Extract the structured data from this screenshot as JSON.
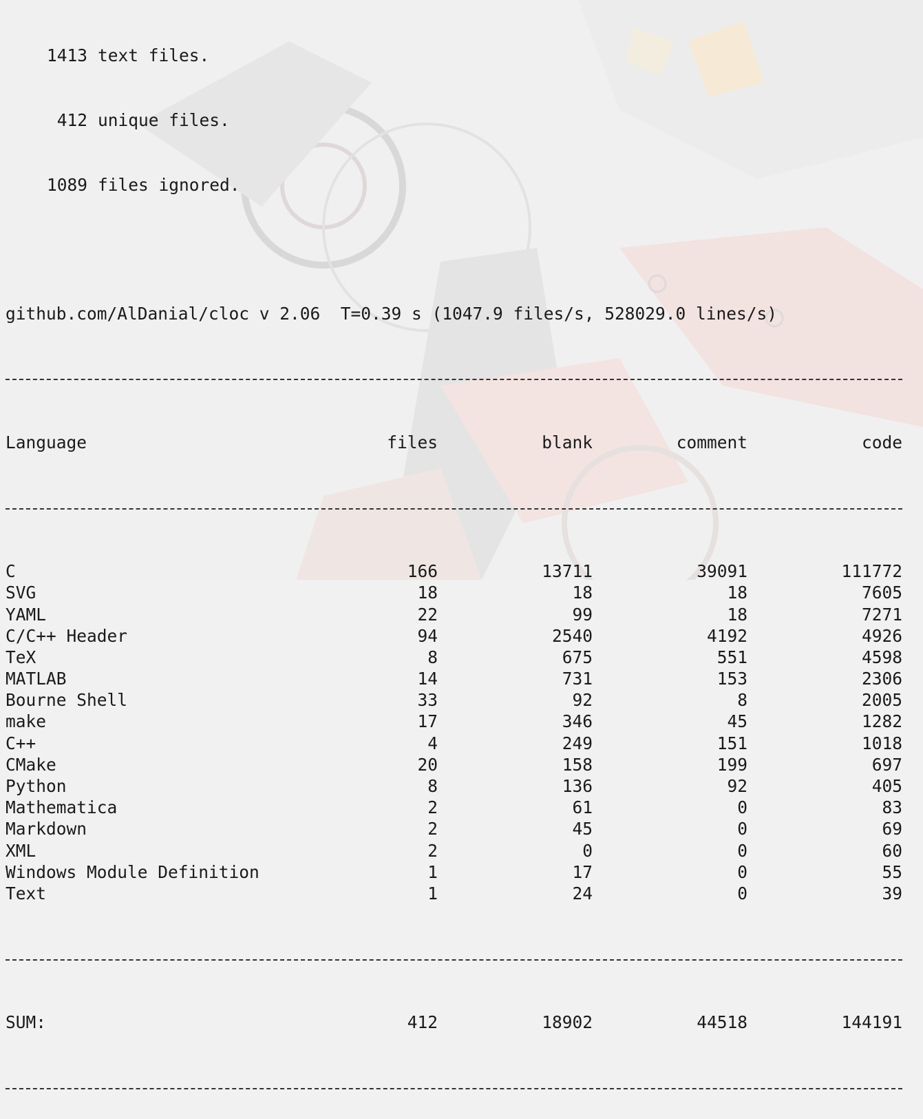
{
  "summary": [
    {
      "count": "1413",
      "text": "text files."
    },
    {
      "count": "412",
      "text": "unique files."
    },
    {
      "count": "1089",
      "text": "files ignored."
    }
  ],
  "header_line": "github.com/AlDanial/cloc v 2.06  T=0.39 s (1047.9 files/s, 528029.0 lines/s)",
  "columns": {
    "language": "Language",
    "files": "files",
    "blank": "blank",
    "comment": "comment",
    "code": "code"
  },
  "rows": [
    {
      "language": "C",
      "files": "166",
      "blank": "13711",
      "comment": "39091",
      "code": "111772"
    },
    {
      "language": "SVG",
      "files": "18",
      "blank": "18",
      "comment": "18",
      "code": "7605"
    },
    {
      "language": "YAML",
      "files": "22",
      "blank": "99",
      "comment": "18",
      "code": "7271"
    },
    {
      "language": "C/C++ Header",
      "files": "94",
      "blank": "2540",
      "comment": "4192",
      "code": "4926"
    },
    {
      "language": "TeX",
      "files": "8",
      "blank": "675",
      "comment": "551",
      "code": "4598"
    },
    {
      "language": "MATLAB",
      "files": "14",
      "blank": "731",
      "comment": "153",
      "code": "2306"
    },
    {
      "language": "Bourne Shell",
      "files": "33",
      "blank": "92",
      "comment": "8",
      "code": "2005"
    },
    {
      "language": "make",
      "files": "17",
      "blank": "346",
      "comment": "45",
      "code": "1282"
    },
    {
      "language": "C++",
      "files": "4",
      "blank": "249",
      "comment": "151",
      "code": "1018"
    },
    {
      "language": "CMake",
      "files": "20",
      "blank": "158",
      "comment": "199",
      "code": "697"
    },
    {
      "language": "Python",
      "files": "8",
      "blank": "136",
      "comment": "92",
      "code": "405"
    },
    {
      "language": "Mathematica",
      "files": "2",
      "blank": "61",
      "comment": "0",
      "code": "83"
    },
    {
      "language": "Markdown",
      "files": "2",
      "blank": "45",
      "comment": "0",
      "code": "69"
    },
    {
      "language": "XML",
      "files": "2",
      "blank": "0",
      "comment": "0",
      "code": "60"
    },
    {
      "language": "Windows Module Definition",
      "files": "1",
      "blank": "17",
      "comment": "0",
      "code": "55"
    },
    {
      "language": "Text",
      "files": "1",
      "blank": "24",
      "comment": "0",
      "code": "39"
    }
  ],
  "sum": {
    "language": "SUM:",
    "files": "412",
    "blank": "18902",
    "comment": "44518",
    "code": "144191"
  }
}
